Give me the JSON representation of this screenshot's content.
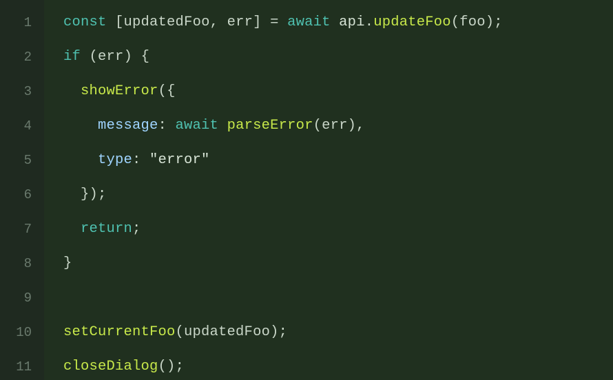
{
  "editor": {
    "line_count": 11,
    "lines": {
      "l1": {
        "num": "1"
      },
      "l2": {
        "num": "2"
      },
      "l3": {
        "num": "3"
      },
      "l4": {
        "num": "4"
      },
      "l5": {
        "num": "5"
      },
      "l6": {
        "num": "6"
      },
      "l7": {
        "num": "7"
      },
      "l8": {
        "num": "8"
      },
      "l9": {
        "num": "9"
      },
      "l10": {
        "num": "10"
      },
      "l11": {
        "num": "11"
      }
    },
    "tokens": {
      "const_kw": "const",
      "await_kw": "await",
      "if_kw": "if",
      "return_kw": "return",
      "updatedFoo": "updatedFoo",
      "err": "err",
      "api": "api",
      "updateFoo": "updateFoo",
      "foo": "foo",
      "showError": "showError",
      "message_key": "message",
      "parseError": "parseError",
      "type_key": "type",
      "error_str": "\"error\"",
      "setCurrentFoo": "setCurrentFoo",
      "closeDialog": "closeDialog",
      "sp": " ",
      "lbracket": "[",
      "rbracket": "]",
      "lparen": "(",
      "rparen": ")",
      "lbrace": "{",
      "rbrace": "}",
      "comma_sp": ", ",
      "comma": ",",
      "eq": " = ",
      "dot": ".",
      "semi": ";",
      "colon_sp": ": ",
      "indent1": "  ",
      "indent2": "    ",
      "indent3": "      "
    }
  }
}
